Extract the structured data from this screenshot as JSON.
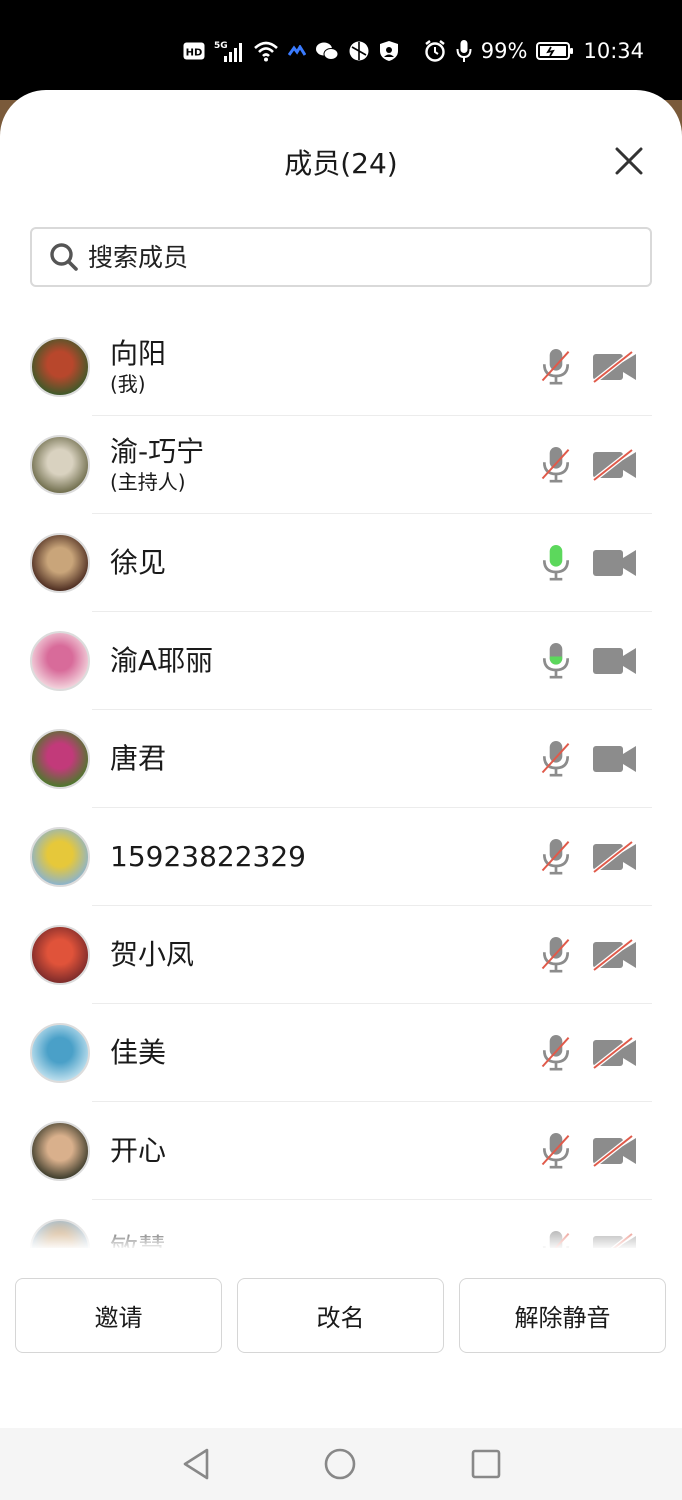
{
  "status_bar": {
    "hd": "HD",
    "network": "5G",
    "battery": "99%",
    "time": "10:34"
  },
  "sheet": {
    "title": "成员(24)",
    "close_icon": "close-icon"
  },
  "search": {
    "placeholder": "搜索成员",
    "value": ""
  },
  "members": [
    {
      "name": "向阳",
      "role": "(我)",
      "mic": "muted",
      "camera": "off",
      "avatar_colors": [
        "#3b5a2a",
        "#b8472c"
      ]
    },
    {
      "name": "渝-巧宁",
      "role": "(主持人)",
      "mic": "muted",
      "camera": "off",
      "avatar_colors": [
        "#6d6b4a",
        "#d9d2c0"
      ]
    },
    {
      "name": "徐见",
      "role": "",
      "mic": "speaking",
      "camera": "on",
      "avatar_colors": [
        "#4a2a1f",
        "#c9a57a"
      ]
    },
    {
      "name": "渝A耶丽",
      "role": "",
      "mic": "active",
      "camera": "on",
      "avatar_colors": [
        "#f3d6de",
        "#d86b9a"
      ]
    },
    {
      "name": "唐君",
      "role": "",
      "mic": "muted",
      "camera": "on",
      "avatar_colors": [
        "#4a7a2a",
        "#c23a7a"
      ]
    },
    {
      "name": "15923822329",
      "role": "",
      "mic": "muted",
      "camera": "off",
      "avatar_colors": [
        "#8ab3cf",
        "#e6c83a"
      ]
    },
    {
      "name": "贺小凤",
      "role": "",
      "mic": "muted",
      "camera": "off",
      "avatar_colors": [
        "#7a2a2a",
        "#e0533a"
      ]
    },
    {
      "name": "佳美",
      "role": "",
      "mic": "muted",
      "camera": "off",
      "avatar_colors": [
        "#bfe0ee",
        "#4aa0c8"
      ]
    },
    {
      "name": "开心",
      "role": "",
      "mic": "muted",
      "camera": "off",
      "avatar_colors": [
        "#3a3a2a",
        "#d9b08c"
      ]
    },
    {
      "name": "敏慧",
      "role": "",
      "mic": "muted",
      "camera": "off",
      "avatar_colors": [
        "#9cc4e4",
        "#c8a070"
      ]
    }
  ],
  "actions": {
    "invite": "邀请",
    "rename": "改名",
    "unmute": "解除静音"
  },
  "colors": {
    "icon_gray": "#8c8c8c",
    "muted_slash": "#e05a4a",
    "speaking_green": "#5cd85c"
  }
}
